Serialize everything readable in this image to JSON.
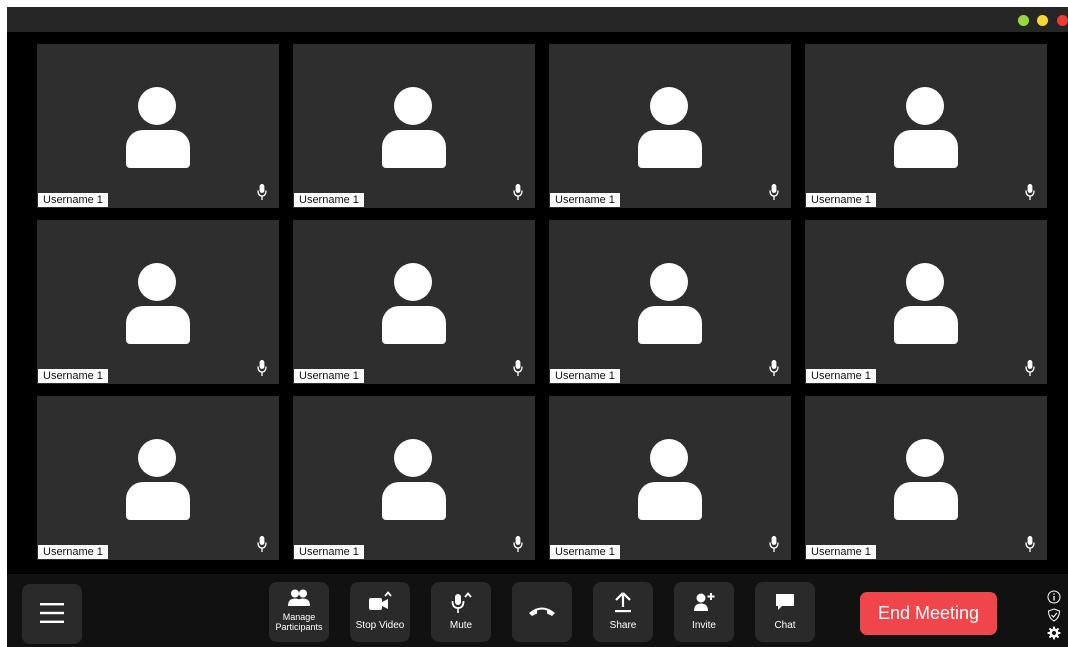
{
  "window": {
    "traffic_lights": {
      "green": "#9ad83a",
      "yellow": "#f6d832",
      "red": "#ee3a33"
    },
    "background": "#000000"
  },
  "participants": [
    {
      "name": "Username 1"
    },
    {
      "name": "Username 1"
    },
    {
      "name": "Username 1"
    },
    {
      "name": "Username 1"
    },
    {
      "name": "Username 1"
    },
    {
      "name": "Username 1"
    },
    {
      "name": "Username 1"
    },
    {
      "name": "Username 1"
    },
    {
      "name": "Username 1"
    },
    {
      "name": "Username 1"
    },
    {
      "name": "Username 1"
    },
    {
      "name": "Username 1"
    }
  ],
  "toolbar": {
    "menu_icon": "hamburger-icon",
    "buttons": [
      {
        "id": "manage-participants",
        "label": "Manage Participants",
        "icon": "participants-icon"
      },
      {
        "id": "stop-video",
        "label": "Stop Video",
        "icon": "video-camera-icon"
      },
      {
        "id": "mute",
        "label": "Mute",
        "icon": "microphone-icon"
      },
      {
        "id": "hang-up",
        "label": "",
        "icon": "phone-hangup-icon"
      },
      {
        "id": "share",
        "label": "Share",
        "icon": "share-upload-icon"
      },
      {
        "id": "invite",
        "label": "Invite",
        "icon": "add-user-icon"
      },
      {
        "id": "chat",
        "label": "Chat",
        "icon": "chat-bubble-icon"
      }
    ],
    "end_meeting_label": "End Meeting",
    "end_meeting_color": "#f0464b",
    "side_icons": [
      "info-icon",
      "shield-icon",
      "settings-gear-icon"
    ]
  }
}
